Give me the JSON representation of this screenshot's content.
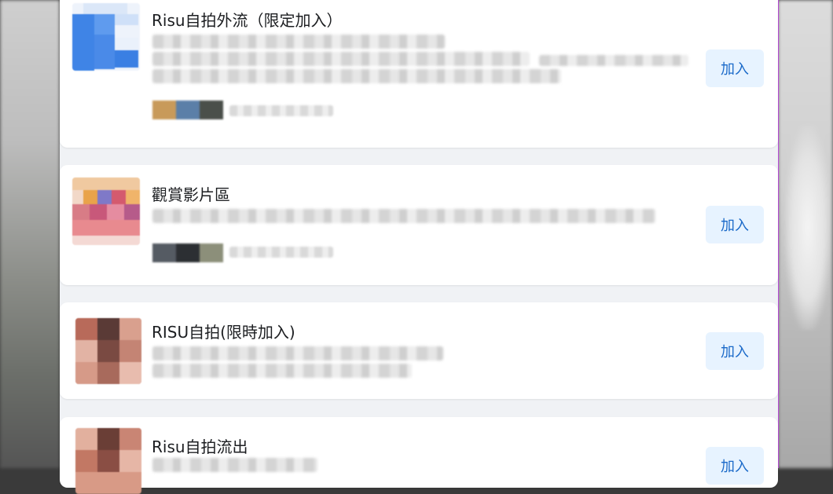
{
  "groups": [
    {
      "name": "Risu自拍外流（限定加入）",
      "join_label": "加入"
    },
    {
      "name": "觀賞影片區",
      "join_label": "加入"
    },
    {
      "name": "RISU自拍(限時加入)",
      "join_label": "加入"
    },
    {
      "name": "Risu自拍流出",
      "join_label": "加入"
    }
  ],
  "colors": {
    "panel_bg": "#f0f2f5",
    "card_bg": "#ffffff",
    "button_bg": "#e7f3ff",
    "button_text": "#1b6ac9"
  }
}
